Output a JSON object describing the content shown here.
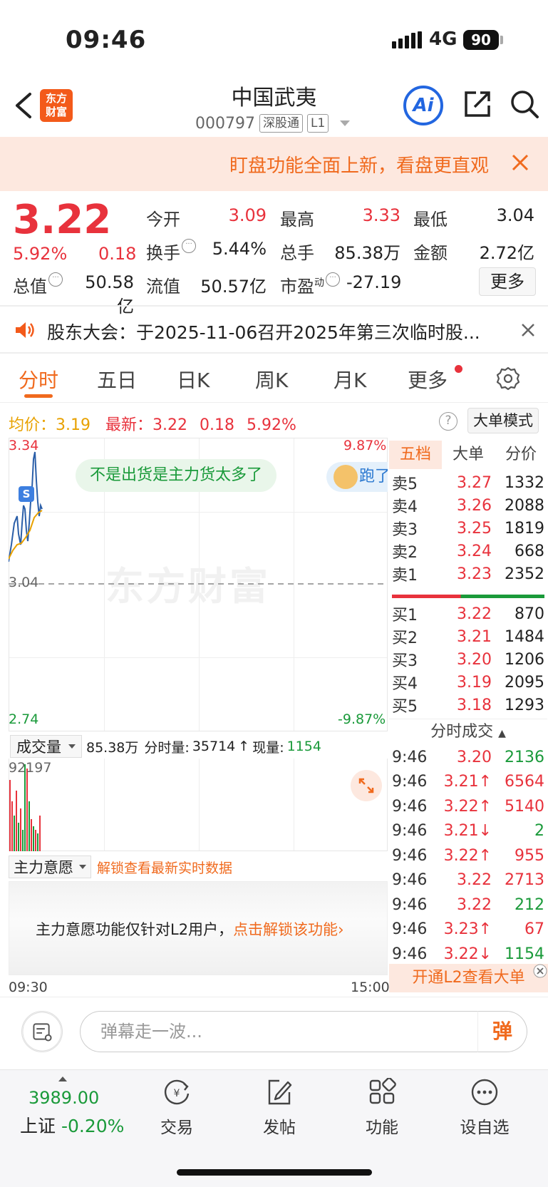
{
  "status": {
    "time": "09:46",
    "network": "4G",
    "battery": "90"
  },
  "header": {
    "logo_line1": "东方",
    "logo_line2": "财富",
    "stock_name": "中国武夷",
    "stock_code": "000797",
    "tag_connect": "深股通",
    "tag_level": "L1",
    "ai_label": "Ai"
  },
  "banner": {
    "text": "盯盘功能全面上新，看盘更直观"
  },
  "quote": {
    "price": "3.22",
    "pct": "5.92%",
    "change": "0.18",
    "open_label": "今开",
    "open": "3.09",
    "high_label": "最高",
    "high": "3.33",
    "low_label": "最低",
    "low": "3.04",
    "turnover_label": "换手",
    "turnover": "5.44%",
    "volume_label": "总手",
    "volume": "85.38万",
    "amount_label": "金额",
    "amount": "2.72亿",
    "mktcap_label": "总值",
    "mktcap": "50.58亿",
    "float_label": "流值",
    "float": "50.57亿",
    "pe_label": "市盈",
    "pe_sup": "动",
    "pe": "-27.19",
    "more_label": "更多"
  },
  "notice": {
    "text": "股东大会：于2025-11-06召开2025年第三次临时股..."
  },
  "tabs": [
    "分时",
    "五日",
    "日K",
    "周K",
    "月K",
    "更多"
  ],
  "info": {
    "avg_label": "均价：",
    "avg": "3.19",
    "latest_label": "最新：",
    "latest": "3.22",
    "change": "0.18",
    "pct": "5.92%",
    "help": "?",
    "mode_btn": "大单模式"
  },
  "chart": {
    "y_high": "3.34",
    "y_mid": "3.04",
    "y_low": "2.74",
    "pct_high": "9.87%",
    "pct_low": "-9.87%",
    "marker": "S",
    "watermark": "东方财富",
    "bubble1": "不是出货是主力货太多了",
    "bubble2": "跑了",
    "time_start": "09:30",
    "time_end": "15:00"
  },
  "volume": {
    "select_label": "成交量",
    "total": "85.38万",
    "fs_label": "分时量:",
    "fs_value": "35714",
    "now_label": "现量:",
    "now_value": "1154",
    "max_label": "92197"
  },
  "main_force": {
    "select_label": "主力意愿",
    "unlock_link": "解锁查看最新实时数据",
    "lock_text": "主力意愿功能仅针对L2用户，",
    "lock_link": "点击解锁该功能"
  },
  "book": {
    "tabs": [
      "五档",
      "大单",
      "分价"
    ],
    "sells": [
      {
        "label": "卖5",
        "price": "3.27",
        "vol": "1332"
      },
      {
        "label": "卖4",
        "price": "3.26",
        "vol": "2088"
      },
      {
        "label": "卖3",
        "price": "3.25",
        "vol": "1819"
      },
      {
        "label": "卖2",
        "price": "3.24",
        "vol": "668"
      },
      {
        "label": "卖1",
        "price": "3.23",
        "vol": "2352"
      }
    ],
    "buys": [
      {
        "label": "买1",
        "price": "3.22",
        "vol": "870"
      },
      {
        "label": "买2",
        "price": "3.21",
        "vol": "1484"
      },
      {
        "label": "买3",
        "price": "3.20",
        "vol": "1206"
      },
      {
        "label": "买4",
        "price": "3.19",
        "vol": "2095"
      },
      {
        "label": "买5",
        "price": "3.18",
        "vol": "1293"
      }
    ],
    "trades_header": "分时成交",
    "trades": [
      {
        "time": "9:46",
        "price": "3.20",
        "vol": "2136",
        "dir": "",
        "vol_color": "green"
      },
      {
        "time": "9:46",
        "price": "3.21↑",
        "vol": "6564",
        "dir": "up",
        "vol_color": "red"
      },
      {
        "time": "9:46",
        "price": "3.22↑",
        "vol": "5140",
        "dir": "up",
        "vol_color": "red"
      },
      {
        "time": "9:46",
        "price": "3.21↓",
        "vol": "2",
        "dir": "down",
        "vol_color": "green"
      },
      {
        "time": "9:46",
        "price": "3.22↑",
        "vol": "955",
        "dir": "up",
        "vol_color": "red"
      },
      {
        "time": "9:46",
        "price": "3.22",
        "vol": "2713",
        "dir": "",
        "vol_color": "red"
      },
      {
        "time": "9:46",
        "price": "3.22",
        "vol": "212",
        "dir": "",
        "vol_color": "green"
      },
      {
        "time": "9:46",
        "price": "3.23↑",
        "vol": "67",
        "dir": "up",
        "vol_color": "red"
      },
      {
        "time": "9:46",
        "price": "3.22↓",
        "vol": "1154",
        "dir": "down",
        "vol_color": "green"
      }
    ],
    "l2_label": "开通L2查看大单"
  },
  "danmaku": {
    "placeholder": "弹幕走一波...",
    "send_label": "弹"
  },
  "bottom": {
    "index_value": "3989.00",
    "index_name": "上证",
    "index_pct": "-0.20%",
    "nav": [
      "交易",
      "发帖",
      "功能",
      "设自选"
    ]
  },
  "colors": {
    "red": "#e8323c",
    "green": "#1a9a3a",
    "orange": "#f06a1e",
    "blue": "#2266e0"
  }
}
